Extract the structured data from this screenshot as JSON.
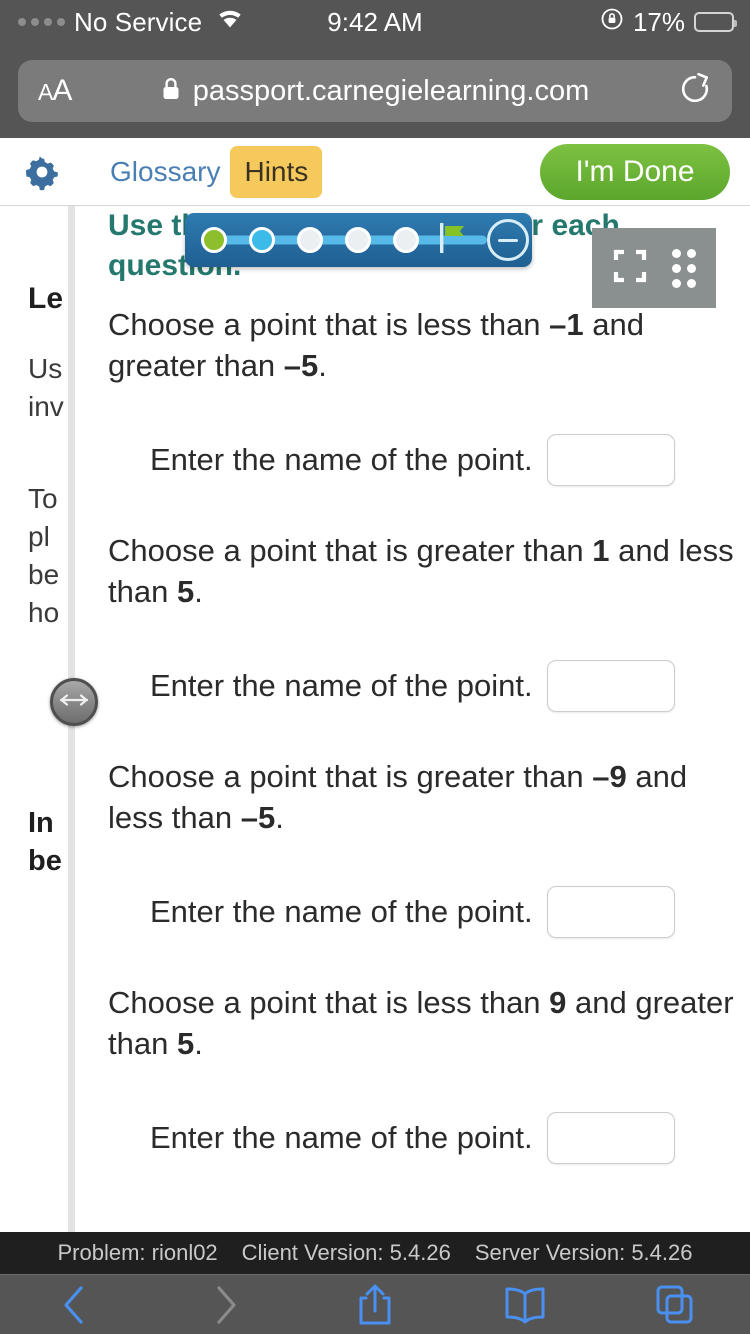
{
  "status_bar": {
    "carrier": "No Service",
    "time": "9:42 AM",
    "battery_percent": "17%",
    "signal_dots": 4,
    "signal_filled": 0,
    "wifi_icon": "wifi-icon",
    "rotation_lock_icon": "rotation-lock-icon",
    "battery_icon": "battery-icon",
    "battery_level": 17
  },
  "browser": {
    "text_size_button": "AA",
    "lock_icon": "lock-icon",
    "url": "passport.carnegielearning.com",
    "reload_icon": "reload-icon",
    "toolbar": {
      "back_icon": "back-chevron-icon",
      "forward_icon": "forward-chevron-icon",
      "share_icon": "share-icon",
      "bookmarks_icon": "book-icon",
      "tabs_icon": "tabs-icon",
      "back_enabled": true,
      "forward_enabled": false
    }
  },
  "app_header": {
    "settings_icon": "gear-icon",
    "glossary_label": "Glossary",
    "hints_label": "Hints",
    "done_label": "I'm Done"
  },
  "progress_widget": {
    "steps": [
      {
        "state": "done"
      },
      {
        "state": "current"
      },
      {
        "state": "todo"
      },
      {
        "state": "todo"
      },
      {
        "state": "todo"
      }
    ],
    "flag_icon": "finish-flag-icon",
    "collapse_icon": "minus-icon"
  },
  "tool_panel": {
    "resize_icon": "collapse-arrows-icon",
    "drag_icon": "drag-handle-dots-icon"
  },
  "left_pane": {
    "title": "Le",
    "lines": [
      "Us",
      "inv"
    ],
    "lines2": [
      "To",
      "pl",
      "be",
      "ho"
    ],
    "subheading": [
      "In",
      "be"
    ],
    "split_handle_icon": "horizontal-resize-icon"
  },
  "problem": {
    "instruction": "Use the number line to answer each question.",
    "questions": [
      {
        "prompt_pre": "Choose a point that is less than ",
        "value_1": "–1",
        "prompt_mid": " and greater than ",
        "value_2": "–5",
        "prompt_end": ".",
        "answer_label": "Enter the name of the point.",
        "answer_value": "",
        "answer_placeholder": ""
      },
      {
        "prompt_pre": "Choose a point that is greater than ",
        "value_1": "1",
        "prompt_mid": " and less than ",
        "value_2": "5",
        "prompt_end": ".",
        "answer_label": "Enter the name of the point.",
        "answer_value": "",
        "answer_placeholder": ""
      },
      {
        "prompt_pre": "Choose a point that is greater than ",
        "value_1": "–9",
        "prompt_mid": " and less than ",
        "value_2": "–5",
        "prompt_end": ".",
        "answer_label": "Enter the name of the point.",
        "answer_value": "",
        "answer_placeholder": ""
      },
      {
        "prompt_pre": "Choose a point that is less than ",
        "value_1": "9",
        "prompt_mid": " and greater than ",
        "value_2": "5",
        "prompt_end": ".",
        "answer_label": "Enter the name of the point.",
        "answer_value": "",
        "answer_placeholder": ""
      }
    ]
  },
  "version_bar": {
    "problem": "Problem: rionl02",
    "client_version": "Client Version: 5.4.26",
    "server_version": "Server Version: 5.4.26"
  },
  "colors": {
    "accent_teal": "#24786e",
    "done_green": "#7ec143",
    "hints_amber": "#f5c95c",
    "link_blue": "#4a7fb5",
    "widget_blue": "#2e7bb0",
    "step_done": "#8cbf2b",
    "step_current": "#3bbce8",
    "chrome_grey": "#555555"
  }
}
